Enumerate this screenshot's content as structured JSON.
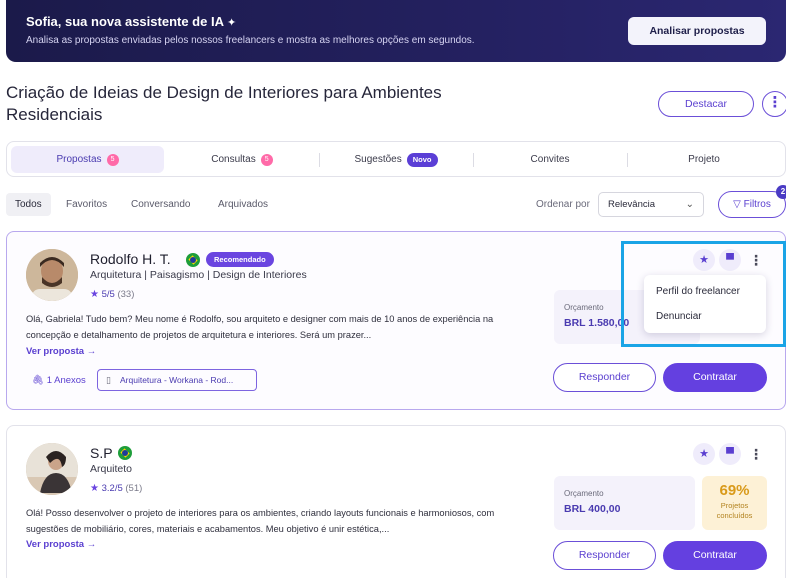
{
  "banner": {
    "title": "Sofia, sua nova assistente de IA",
    "subtitle": "Analisa as propostas enviadas pelos nossos freelancers e mostra as melhores opções em segundos.",
    "button": "Analisar propostas"
  },
  "project": {
    "title": "Criação de Ideias de Design de Interiores para Ambientes Residenciais",
    "highlight_button": "Destacar"
  },
  "tabs": [
    {
      "label": "Propostas",
      "count": "5",
      "active": true
    },
    {
      "label": "Consultas",
      "count": "5"
    },
    {
      "label": "Sugestões",
      "badge": "Novo"
    },
    {
      "label": "Convites"
    },
    {
      "label": "Projeto"
    }
  ],
  "filters": [
    "Todos",
    "Favoritos",
    "Conversando",
    "Arquivados"
  ],
  "order": {
    "label": "Ordenar por",
    "value": "Relevância"
  },
  "filter_button": {
    "label": "Filtros",
    "count": "2"
  },
  "proposals": [
    {
      "name": "Rodolfo H. T.",
      "badge": "Recomendado",
      "role": "Arquitetura | Paisagismo | Design de Interiores",
      "rating": "5/5",
      "reviews": "(33)",
      "description": "Olá, Gabriela! Tudo bem? Meu nome é Rodolfo, sou arquiteto e designer com mais de 10 anos de experiência na concepção e detalhamento de projetos de arquitetura e interiores. Será um prazer...",
      "view_link": "Ver proposta →",
      "attachments": "1 Anexos",
      "attachment_file": "Arquitetura - Workana - Rod...",
      "budget_label": "Orçamento",
      "budget_value": "BRL 1.580,00",
      "respond": "Responder",
      "hire": "Contratar"
    },
    {
      "name": "S.P",
      "role": "Arquiteto",
      "rating": "3.2/5",
      "reviews": "(51)",
      "description": "Olá! Posso desenvolver o projeto de interiores para os ambientes, criando layouts funcionais e harmoniosos, com sugestões de mobiliário, cores, materiais e acabamentos. Meu objetivo é unir estética,...",
      "view_link": "Ver proposta →",
      "budget_label": "Orçamento",
      "budget_value": "BRL 400,00",
      "projects_pct": "69%",
      "projects_label": "Projetos concluídos",
      "respond": "Responder",
      "hire": "Contratar"
    }
  ],
  "dropdown_menu": [
    "Perfil do freelancer",
    "Denunciar"
  ],
  "colors": {
    "accent": "#6440e0",
    "highlight": "#1aa4e6",
    "banner": "#1b1a4a"
  }
}
